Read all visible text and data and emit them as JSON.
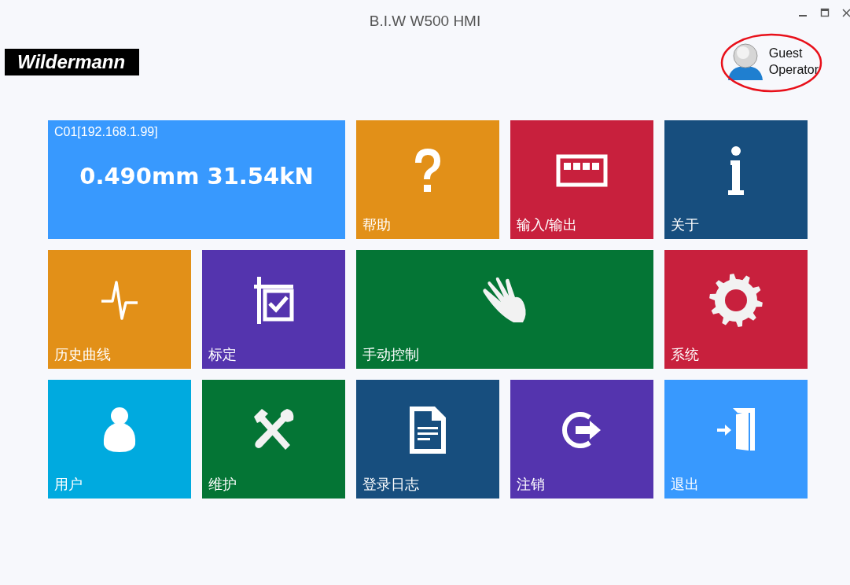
{
  "window": {
    "title": "B.I.W W500 HMI"
  },
  "logo": {
    "text": "Wildermann"
  },
  "user": {
    "name": "Guest",
    "role": "Operator"
  },
  "status_tile": {
    "station": "C01[192.168.1.99]",
    "reading": "0.490mm 31.54kN",
    "color": "#3899fe"
  },
  "tiles": [
    {
      "label": "帮助",
      "kind": "help",
      "color": "#e29018",
      "wide": false
    },
    {
      "label": "输入/输出",
      "kind": "io",
      "color": "#c8203d",
      "wide": false
    },
    {
      "label": "关于",
      "kind": "info",
      "color": "#174e7e",
      "wide": false
    },
    {
      "label": "历史曲线",
      "kind": "pulse",
      "color": "#e29018",
      "wide": false
    },
    {
      "label": "标定",
      "kind": "calibrate",
      "color": "#5434ae",
      "wide": false
    },
    {
      "label": "手动控制",
      "kind": "hand",
      "color": "#047535",
      "wide": true
    },
    {
      "label": "系统",
      "kind": "gear",
      "color": "#c8203d",
      "wide": false
    },
    {
      "label": "用户",
      "kind": "user",
      "color": "#00aadf",
      "wide": false
    },
    {
      "label": "维护",
      "kind": "tools",
      "color": "#047535",
      "wide": false
    },
    {
      "label": "登录日志",
      "kind": "document",
      "color": "#174e7e",
      "wide": false
    },
    {
      "label": "注销",
      "kind": "logout",
      "color": "#5434ae",
      "wide": false
    },
    {
      "label": "退出",
      "kind": "exit",
      "color": "#3899fe",
      "wide": false
    }
  ]
}
